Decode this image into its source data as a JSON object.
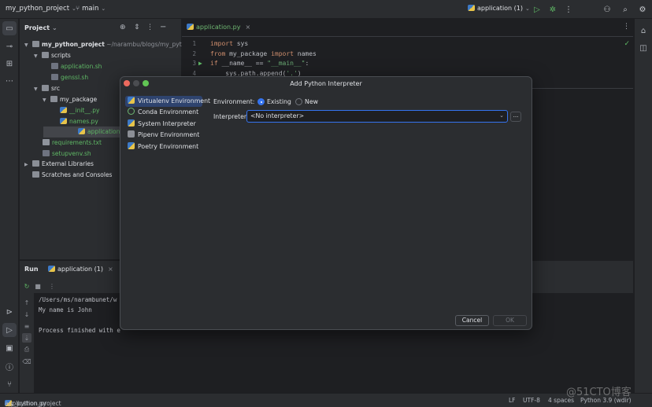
{
  "titlebar": {
    "project": "my_python_project",
    "branch": "main",
    "run_config": "application (1)"
  },
  "project_panel": {
    "title": "Project",
    "tree": [
      {
        "label": "my_python_project",
        "suffix": "~/narambu/blogs/my_python_",
        "type": "folder",
        "bold": true
      },
      {
        "label": "scripts",
        "type": "folder"
      },
      {
        "label": "application.sh",
        "type": "sh",
        "status": "green"
      },
      {
        "label": "genssl.sh",
        "type": "sh",
        "status": "green"
      },
      {
        "label": "src",
        "type": "folder"
      },
      {
        "label": "my_package",
        "type": "folder"
      },
      {
        "label": "__init__.py",
        "type": "py",
        "status": "green"
      },
      {
        "label": "names.py",
        "type": "py",
        "status": "green"
      },
      {
        "label": "application.py",
        "type": "py",
        "status": "green",
        "selected": true
      },
      {
        "label": "requirements.txt",
        "type": "txt",
        "status": "green"
      },
      {
        "label": "setupvenv.sh",
        "type": "sh",
        "status": "green"
      },
      {
        "label": "External Libraries",
        "type": "lib"
      },
      {
        "label": "Scratches and Consoles",
        "type": "scratch"
      }
    ]
  },
  "editor": {
    "tab": "application.py",
    "lines": [
      {
        "num": "1",
        "parts": [
          [
            "kw",
            "import"
          ],
          [
            "plain",
            " sys"
          ]
        ]
      },
      {
        "num": "2",
        "parts": [
          [
            "kw",
            "from"
          ],
          [
            "plain",
            " my_package "
          ],
          [
            "kw",
            "import"
          ],
          [
            "plain",
            " names"
          ]
        ]
      },
      {
        "num": "3",
        "parts": [
          [
            "kw",
            "if"
          ],
          [
            "plain",
            " __name__ == "
          ],
          [
            "str",
            "\"__main__\""
          ],
          [
            "plain",
            ":"
          ]
        ]
      },
      {
        "num": "4",
        "parts": [
          [
            "plain",
            "    sys.path.append("
          ],
          [
            "str",
            "'.'"
          ],
          [
            "plain",
            ")"
          ]
        ]
      }
    ]
  },
  "run_panel": {
    "title": "Run",
    "tab": "application (1)",
    "console": [
      "/Users/ms/narambunet/w",
      "My name is John",
      "",
      "Process finished with e"
    ]
  },
  "dialog": {
    "title": "Add Python Interpreter",
    "environments": [
      {
        "label": "Virtualenv Environment",
        "icon": "python-icon",
        "selected": true
      },
      {
        "label": "Conda Environment",
        "icon": "conda-icon"
      },
      {
        "label": "System Interpreter",
        "icon": "python-icon"
      },
      {
        "label": "Pipenv Environment",
        "icon": "pipenv-icon"
      },
      {
        "label": "Poetry Environment",
        "icon": "python-icon"
      }
    ],
    "environment_label": "Environment:",
    "option_existing": "Existing",
    "option_new": "New",
    "selected_option": "Existing",
    "interpreter_label": "Interpreter:",
    "interpreter_value": "<No interpreter>",
    "browse_label": "...",
    "cancel_label": "Cancel",
    "ok_label": "OK"
  },
  "statusbar": {
    "crumbs": [
      "my_python_project",
      "src",
      "application.py"
    ],
    "line_sep": "LF",
    "encoding": "UTF-8",
    "indent": "4 spaces",
    "interpreter": "Python 3.9 (wdir)"
  },
  "watermark": "@51CTO博客",
  "colors": {
    "accent": "#3574f0",
    "vcs_green": "#6fb872",
    "keyword": "#cf8e6d",
    "string": "#6aab73"
  }
}
